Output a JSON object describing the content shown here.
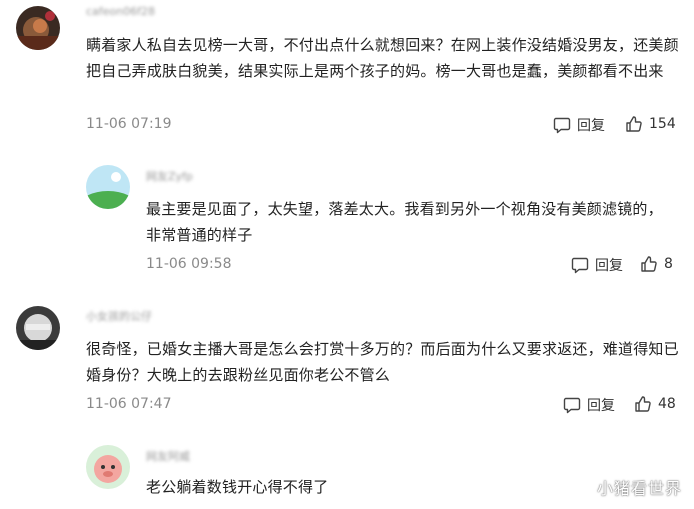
{
  "comments": [
    {
      "username": "cafeon06f28",
      "text": "瞒着家人私自去见榜一大哥，不付出点什么就想回来？在网上装作没结婚没男友，还美颜把自己弄成肤白貌美，结果实际上是两个孩子的妈。榜一大哥也是蠢，美颜都看不出来",
      "time": "11-06 07:19",
      "reply_label": "回复",
      "likes": "154"
    },
    {
      "username": "网友Zyfp",
      "text": "最主要是见面了，太失望，落差太大。我看到另外一个视角没有美颜滤镜的，非常普通的样子",
      "time": "11-06 09:58",
      "reply_label": "回复",
      "likes": "8"
    },
    {
      "username": "小女孩的公仔",
      "text": "很奇怪，已婚女主播大哥是怎么会打赏十多万的？而后面为什么又要求返还，难道得知已婚身份？大晚上的去跟粉丝见面你老公不管么",
      "time": "11-06 07:47",
      "reply_label": "回复",
      "likes": "48"
    },
    {
      "username": "网友阿威",
      "text": "老公躺着数钱开心得不得了"
    }
  ],
  "watermark": "小猪看世界",
  "icons": [
    "comment-icon",
    "thumbs-up-icon"
  ],
  "colors": {
    "text": "#222222",
    "meta": "#8a8a8a",
    "background": "#ffffff"
  }
}
